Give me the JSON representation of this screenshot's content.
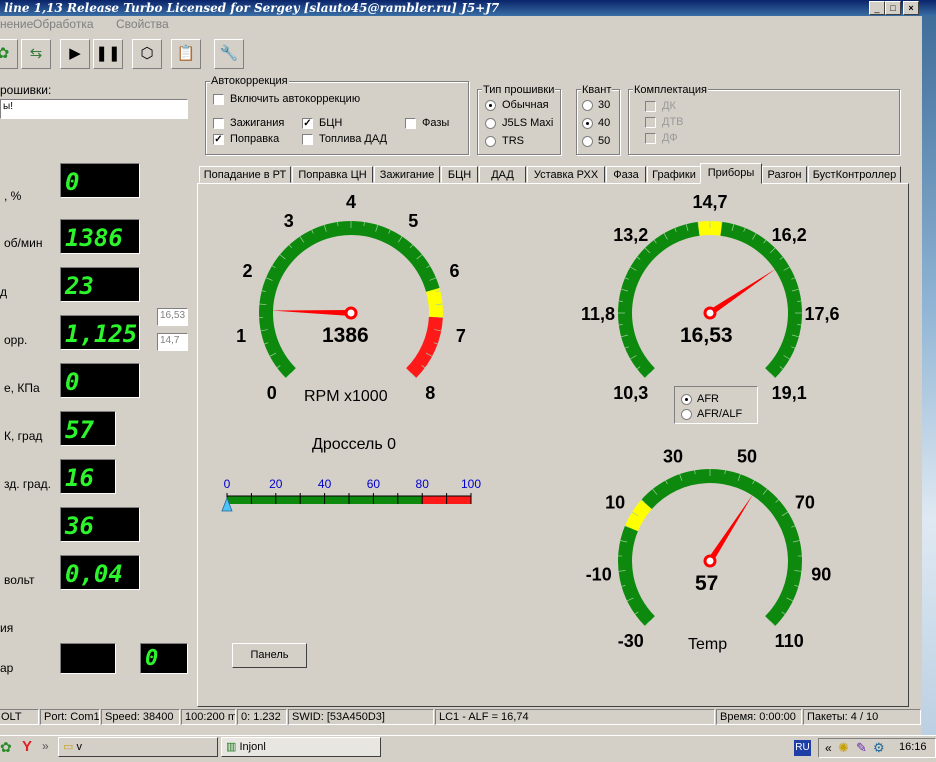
{
  "window": {
    "title": "line 1,13 Release Turbo  Licensed for Sergey [slauto45@rambler.ru] J5+J7",
    "min": "_",
    "max": "□",
    "close": "×"
  },
  "menu": [
    "нение",
    "Обработка",
    "Свойства"
  ],
  "left": {
    "firmware_label": "рошивки:",
    "firmware_value": "ы!",
    "rows": [
      {
        "label": ", %",
        "value": "0"
      },
      {
        "label": "об/мин",
        "value": "1386"
      },
      {
        "label": "д",
        "value": "23"
      },
      {
        "label": "орр.",
        "value": "1,125"
      },
      {
        "label": "е, КПа",
        "value": "0"
      },
      {
        "label": "К, град",
        "value": "57"
      },
      {
        "label": "зд. град.",
        "value": "16"
      },
      {
        "label": "",
        "value": "36"
      },
      {
        "label": "вольт",
        "value": "0,04"
      },
      {
        "label": "ия",
        "value": ""
      },
      {
        "label": "ар",
        "value": "0"
      }
    ],
    "side_field_1": "16,53",
    "side_field_2": "14,7"
  },
  "autocorr": {
    "legend": "Автокоррекция",
    "enable": "Включить автокоррекцию",
    "ign": "Зажигания",
    "bcn": "БЦН",
    "phases": "Фазы",
    "correction": "Поправка",
    "fuel_dad": "Топлива ДАД"
  },
  "fwtype": {
    "legend": "Тип прошивки",
    "opt1": "Обычная",
    "opt2": "J5LS Maxi",
    "opt3": "TRS"
  },
  "quant": {
    "legend": "Квант",
    "opt1": "30",
    "opt2": "40",
    "opt3": "50"
  },
  "equip": {
    "legend": "Комплектация",
    "opt1": "ДК",
    "opt2": "ДТВ",
    "opt3": "ДФ"
  },
  "tabs": [
    "Попадание в РТ",
    "Поправка ЦН",
    "Зажигание",
    "БЦН",
    "ДАД",
    "Уставка РХХ",
    "Фаза",
    "Графики",
    "Приборы",
    "Разгон",
    "БустКонтроллер"
  ],
  "rpm_gauge": {
    "ticks": [
      "0",
      "1",
      "2",
      "3",
      "4",
      "5",
      "6",
      "7",
      "8"
    ],
    "value": "1386",
    "unit": "RPM x1000",
    "needle_value": 1.386
  },
  "afr_gauge": {
    "ticks": [
      "10,3",
      "11,8",
      "13,2",
      "14,7",
      "16,2",
      "17,6",
      "19,1"
    ],
    "value": "16,53",
    "needle_value": 16.53,
    "mode1": "AFR",
    "mode2": "AFR/ALF"
  },
  "temp_gauge": {
    "ticks": [
      "-30",
      "-10",
      "10",
      "30",
      "50",
      "70",
      "90",
      "110"
    ],
    "value": "57",
    "label": "Temp",
    "needle_value": 57
  },
  "throttle": {
    "title": "Дроссель 0",
    "ticks": [
      "0",
      "20",
      "40",
      "60",
      "80",
      "100"
    ],
    "value": 0
  },
  "panel_button": "Панель",
  "status": [
    "OLT",
    "Port: Com1",
    "Speed: 38400",
    "100:200 m",
    "0: 1.232",
    "SWID: [53A450D3]",
    "LC1 - ALF = 16,74",
    "Время: 0:00:00",
    "Пакеты: 4 / 10"
  ],
  "taskbar": {
    "folder": "v",
    "app": "Injonl",
    "lang": "RU",
    "tray_arrows": "«",
    "time": "16:16"
  },
  "colors": {
    "gauge_green": "#0d8a0d",
    "gauge_yellow": "#ffff00",
    "gauge_red": "#ff1a1a",
    "needle": "#ff0000",
    "led_text": "#2cf52c"
  }
}
